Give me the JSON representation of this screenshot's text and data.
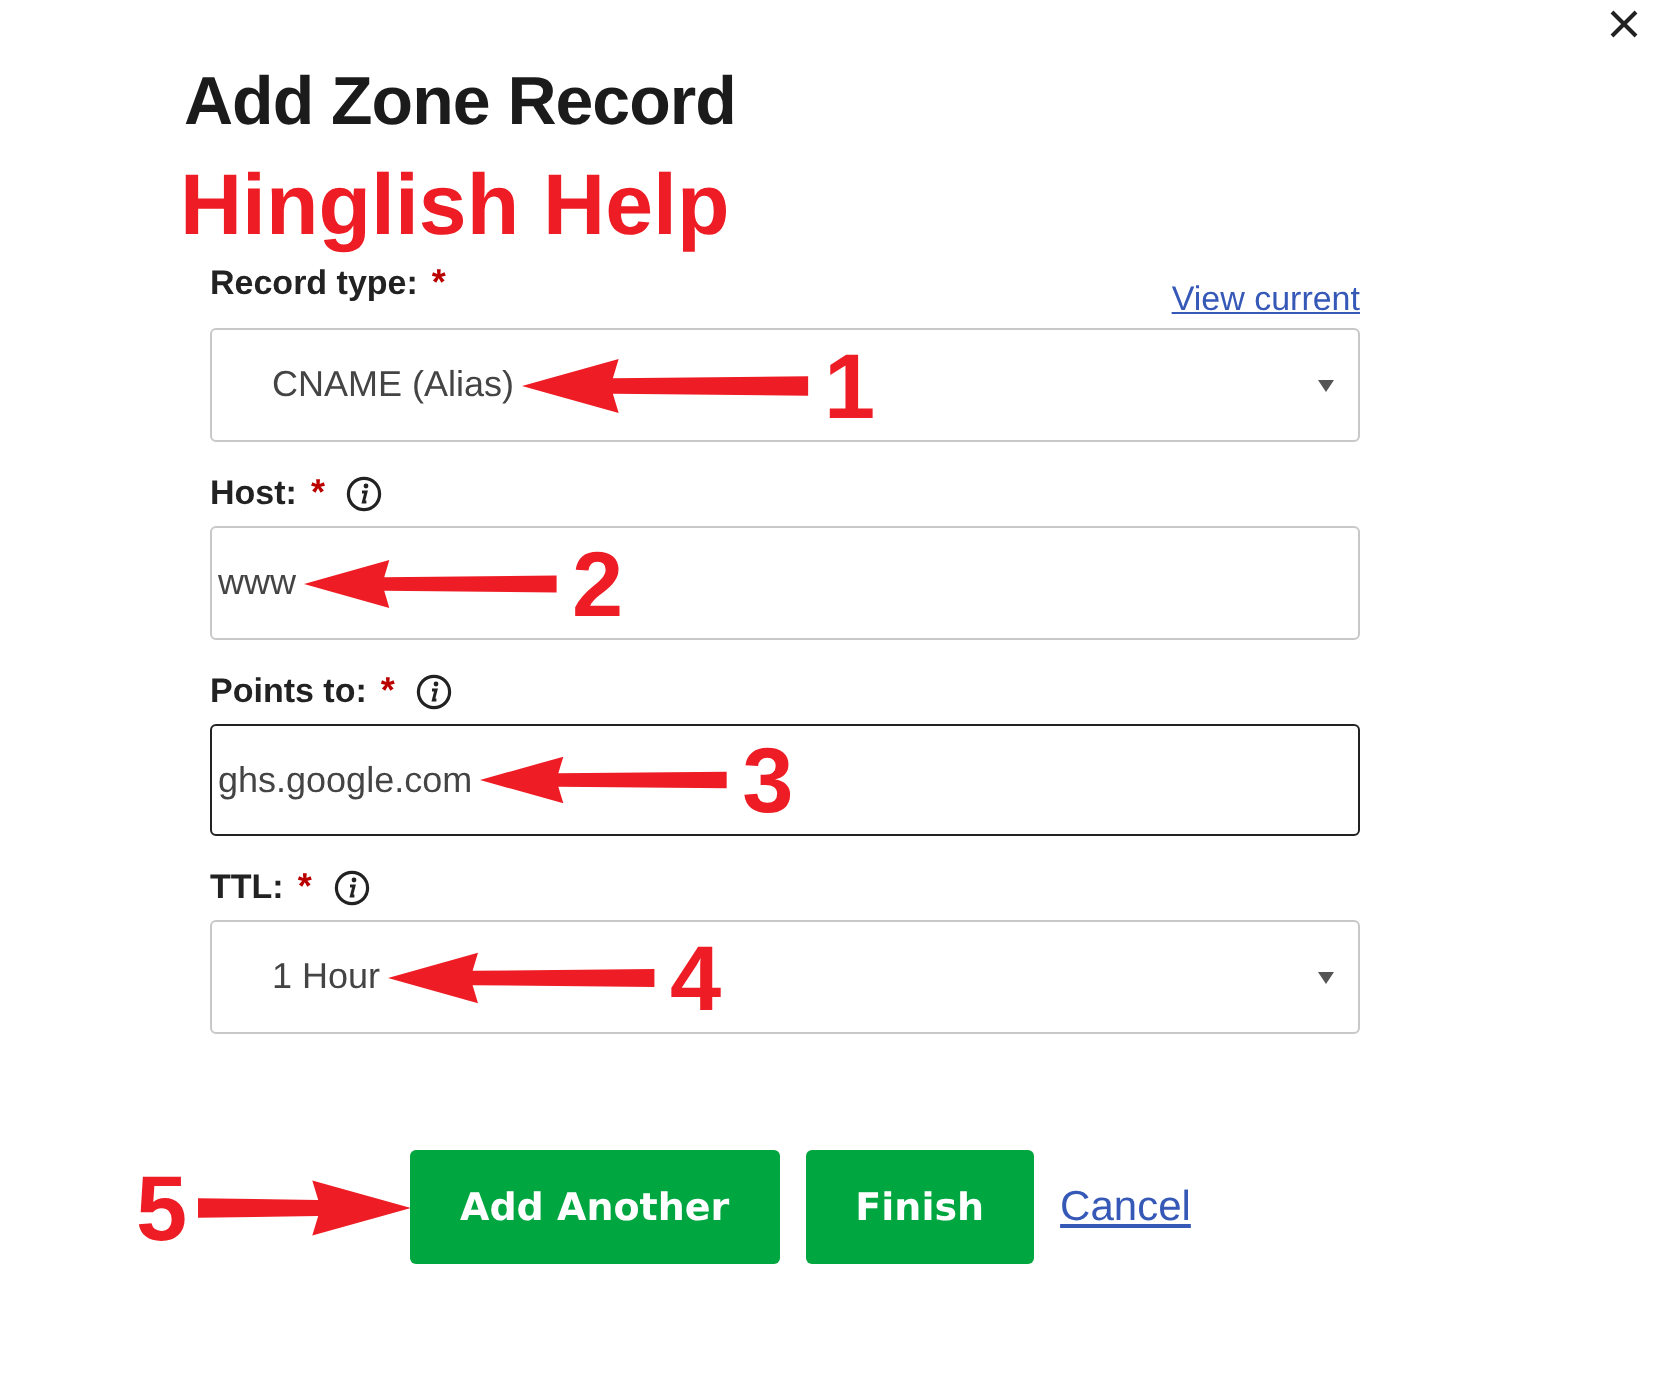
{
  "dialog": {
    "title": "Add Zone Record"
  },
  "caption": "Hinglish Help",
  "view_current_link": "View current",
  "fields": [
    {
      "kind": "select",
      "label": "Record type:",
      "required_mark": "*",
      "info": false,
      "value": "CNAME (Alias)",
      "focused": false,
      "annotation": "1"
    },
    {
      "kind": "text",
      "label": "Host:",
      "required_mark": "*",
      "info": true,
      "value": "www",
      "focused": false,
      "annotation": "2"
    },
    {
      "kind": "text",
      "label": "Points to:",
      "required_mark": "*",
      "info": true,
      "value": "ghs.google.com",
      "focused": true,
      "annotation": "3"
    },
    {
      "kind": "select",
      "label": "TTL:",
      "required_mark": "*",
      "info": true,
      "value": "1 Hour",
      "focused": false,
      "annotation": "4"
    }
  ],
  "buttons": [
    {
      "kind": "primary",
      "label": "Add Another",
      "annotation": "5"
    },
    {
      "kind": "primary",
      "label": "Finish"
    },
    {
      "kind": "link",
      "label": "Cancel"
    }
  ]
}
